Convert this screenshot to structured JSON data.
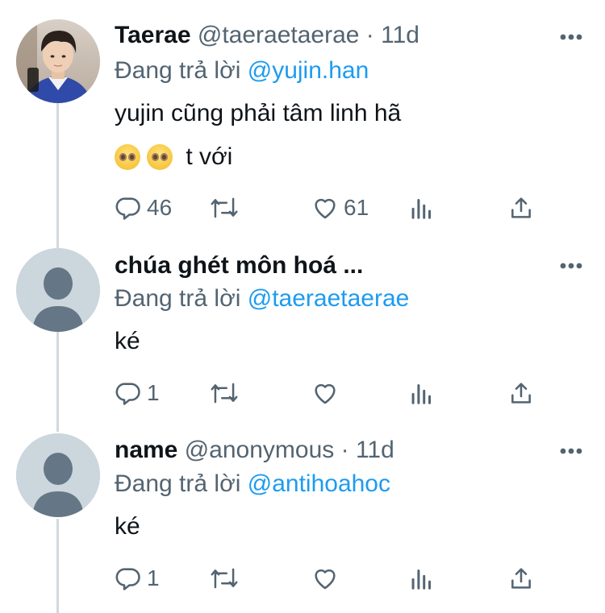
{
  "tweets": [
    {
      "name": "Taerae",
      "handle": "@taeraetaerae",
      "dot": " · ",
      "time": "11d",
      "replying_prefix": "Đang trả lời ",
      "replying_to": "@yujin.han",
      "text_line1": "yujin cũng phải tâm linh hã",
      "text_line2": " t với",
      "emoji": [
        "pleading-face",
        "pleading-face"
      ],
      "replies": "46",
      "retweets": "",
      "likes": "61",
      "has_photo_avatar": true
    },
    {
      "name": "chúa ghét môn hoá ...",
      "handle": "",
      "dot": "",
      "time": "",
      "replying_prefix": "Đang trả lời ",
      "replying_to": "@taeraetaerae",
      "text_line1": "ké",
      "replies": "1",
      "retweets": "",
      "likes": ""
    },
    {
      "name": "name",
      "handle": "@anonymous",
      "dot": " · ",
      "time": "11d",
      "replying_prefix": "Đang trả lời ",
      "replying_to": "@antihoahoc",
      "text_line1": "ké",
      "replies": "1",
      "retweets": "",
      "likes": ""
    }
  ],
  "colors": {
    "text": "#0f1419",
    "secondary": "#536471",
    "mention": "#1d9bf0",
    "thread_line": "#cfd9de",
    "default_avatar_bg": "#ccd6dd",
    "default_avatar_fg": "#657786"
  },
  "icons": [
    "more-icon",
    "reply-icon",
    "retweet-icon",
    "like-icon",
    "analytics-icon",
    "share-icon"
  ]
}
